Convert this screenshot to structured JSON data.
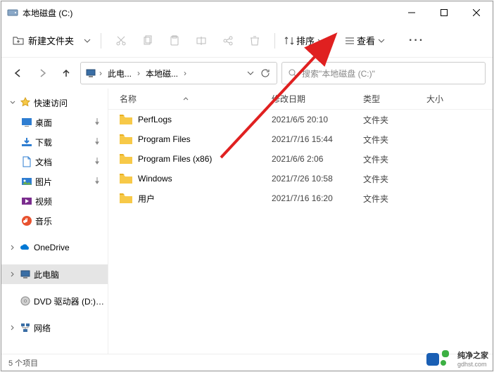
{
  "title": "本地磁盘 (C:)",
  "cmdbar": {
    "new_folder": "新建文件夹",
    "sort": "排序",
    "view": "查看"
  },
  "breadcrumb": {
    "pc": "此电...",
    "disk": "本地磁..."
  },
  "search": {
    "placeholder": "搜索\"本地磁盘 (C:)\""
  },
  "sidebar": {
    "quick": "快速访问",
    "desktop": "桌面",
    "downloads": "下载",
    "documents": "文档",
    "pictures": "图片",
    "videos": "视频",
    "music": "音乐",
    "onedrive": "OneDrive",
    "thispc": "此电脑",
    "dvd": "DVD 驱动器 (D:) CF",
    "network": "网络"
  },
  "columns": {
    "name": "名称",
    "date": "修改日期",
    "type": "类型",
    "size": "大小"
  },
  "files": [
    {
      "name": "PerfLogs",
      "date": "2021/6/5 20:10",
      "type": "文件夹"
    },
    {
      "name": "Program Files",
      "date": "2021/7/16 15:44",
      "type": "文件夹"
    },
    {
      "name": "Program Files (x86)",
      "date": "2021/6/6 2:06",
      "type": "文件夹"
    },
    {
      "name": "Windows",
      "date": "2021/7/26 10:58",
      "type": "文件夹"
    },
    {
      "name": "用户",
      "date": "2021/7/16 16:20",
      "type": "文件夹"
    }
  ],
  "status": "5 个项目",
  "watermark": {
    "brand": "纯净之家",
    "url": "gdhst.com"
  }
}
